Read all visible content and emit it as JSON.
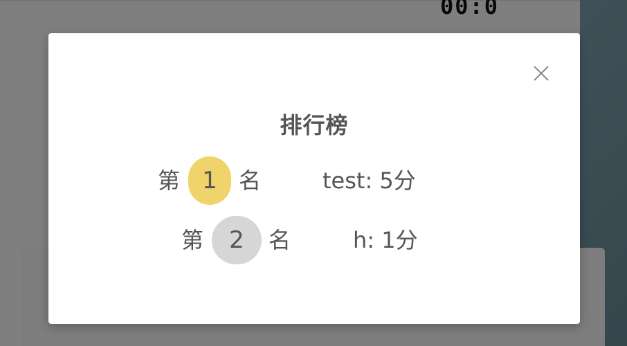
{
  "background": {
    "timer": "00:0"
  },
  "modal": {
    "title": "排行榜",
    "close_icon": "close-icon",
    "rankings": [
      {
        "prefix": "第",
        "rank": "1",
        "suffix": "名",
        "entry": "test: 5分",
        "badge_color": "#f1d36b"
      },
      {
        "prefix": "第",
        "rank": "2",
        "suffix": "名",
        "entry": "h: 1分",
        "badge_color": "#d6d6d6"
      }
    ]
  }
}
